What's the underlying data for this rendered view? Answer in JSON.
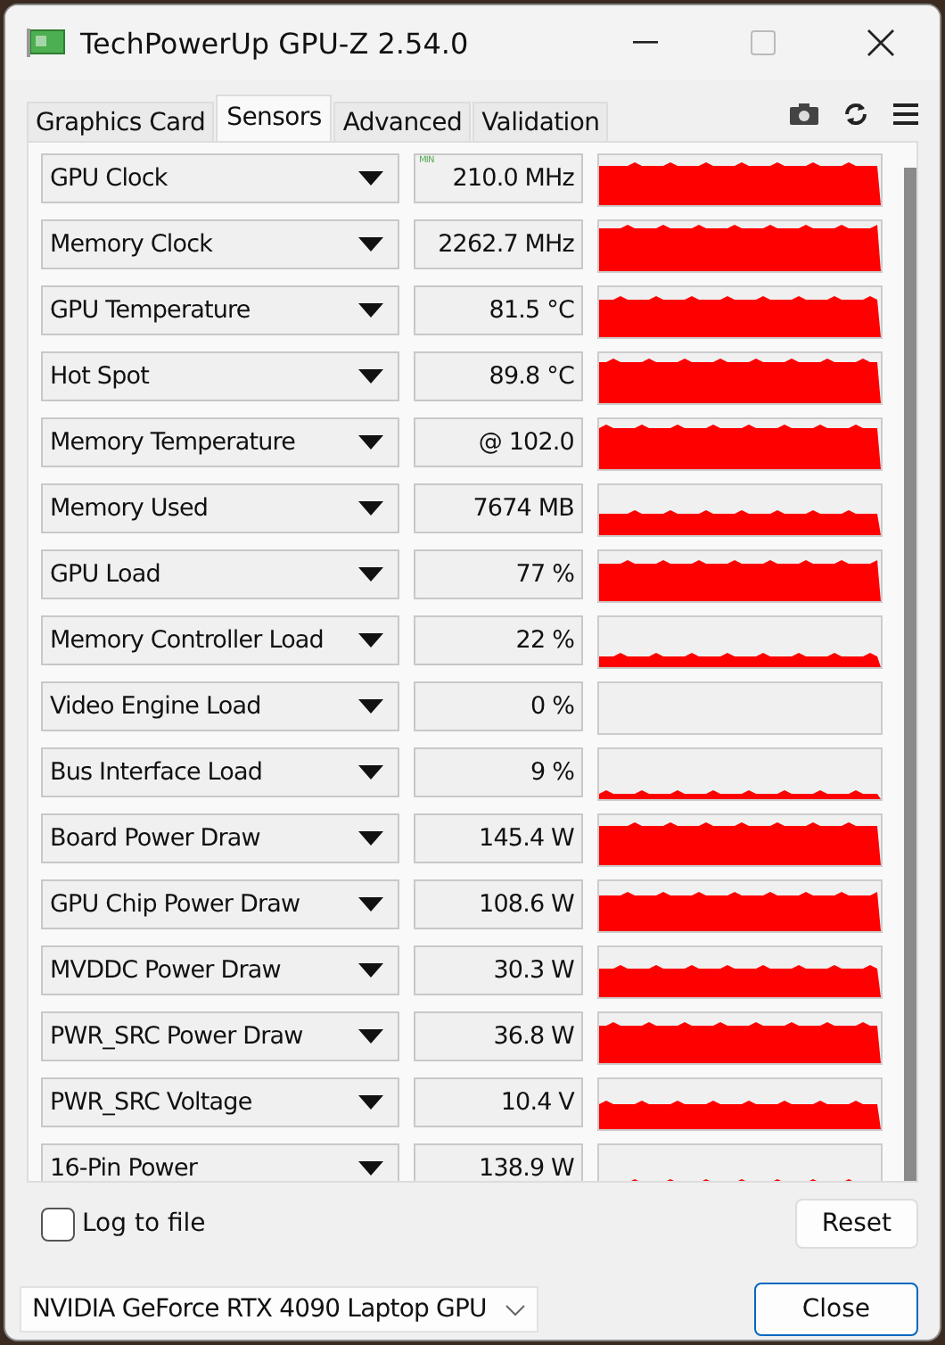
{
  "window": {
    "title": "TechPowerUp GPU-Z 2.54.0"
  },
  "tabs": [
    {
      "label": "Graphics Card",
      "selected": false
    },
    {
      "label": "Sensors",
      "selected": true
    },
    {
      "label": "Advanced",
      "selected": false
    },
    {
      "label": "Validation",
      "selected": false
    }
  ],
  "sensors": [
    {
      "name": "GPU Clock",
      "value": "210.0 MHz",
      "badge": "MIN"
    },
    {
      "name": "Memory Clock",
      "value": "2262.7 MHz"
    },
    {
      "name": "GPU Temperature",
      "value": "81.5 °C"
    },
    {
      "name": "Hot Spot",
      "value": "89.8 °C"
    },
    {
      "name": "Memory Temperature",
      "value": "@ 102.0"
    },
    {
      "name": "Memory Used",
      "value": "7674 MB"
    },
    {
      "name": "GPU Load",
      "value": "77 %"
    },
    {
      "name": "Memory Controller Load",
      "value": "22 %"
    },
    {
      "name": "Video Engine Load",
      "value": "0 %"
    },
    {
      "name": "Bus Interface Load",
      "value": "9 %"
    },
    {
      "name": "Board Power Draw",
      "value": "145.4 W"
    },
    {
      "name": "GPU Chip Power Draw",
      "value": "108.6 W"
    },
    {
      "name": "MVDDC Power Draw",
      "value": "30.3 W"
    },
    {
      "name": "PWR_SRC Power Draw",
      "value": "36.8 W"
    },
    {
      "name": "PWR_SRC Voltage",
      "value": "10.4 V"
    },
    {
      "name": "16-Pin Power",
      "value": "138.9 W"
    }
  ],
  "log_to_file": {
    "label": "Log to file",
    "checked": false
  },
  "reset_button": "Reset",
  "gpu_select": {
    "value": "NVIDIA GeForce RTX 4090 Laptop GPU"
  },
  "close_button": "Close"
}
